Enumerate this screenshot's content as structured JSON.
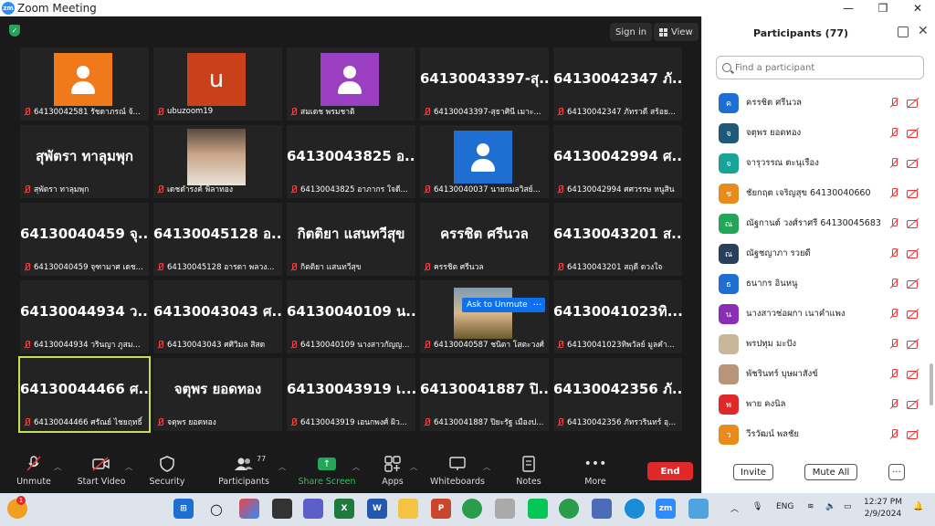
{
  "window": {
    "title": "Zoom Meeting",
    "logo_text": "zm"
  },
  "top_bar": {
    "sign_in": "Sign in",
    "view": "View"
  },
  "tiles": [
    {
      "kind": "avatar",
      "color": "#f07a1a",
      "name": "64130042581 รัชดาภรณ์ จ้..."
    },
    {
      "kind": "letter",
      "color": "#c9401b",
      "letter": "u",
      "name": "ubuzoom19"
    },
    {
      "kind": "avatar",
      "color": "#9a3fc1",
      "name": "สมเดช พรมชาติ"
    },
    {
      "kind": "text",
      "big": "64130043397-สุ...",
      "name": "64130043397-สุธาศินี เมาะ..."
    },
    {
      "kind": "text",
      "big": "64130042347 ภั...",
      "name": "64130042347 ภัทรวดี สร้อย..."
    },
    {
      "kind": "text",
      "big": "สุพัตรา ทาลุมพุก",
      "name": "สุพัตรา ทาลุมพุก"
    },
    {
      "kind": "photo",
      "name": "เดชดำรงค์ พิลาทอง"
    },
    {
      "kind": "text",
      "big": "64130043825 อ...",
      "name": "64130043825 อาภากร ใจดี..."
    },
    {
      "kind": "avatar",
      "color": "#1e6fd1",
      "name": "64130040037 นายกมลวิสย์..."
    },
    {
      "kind": "text",
      "big": "64130042994 ศ...",
      "name": "64130042994 ศศวรรษ หนูสิน"
    },
    {
      "kind": "text",
      "big": "64130040459 จุ...",
      "name": "64130040459 จุฑามาศ เดช..."
    },
    {
      "kind": "text",
      "big": "64130045128 อ...",
      "name": "64130045128 อารดา พลวง..."
    },
    {
      "kind": "text",
      "big": "กิตติยา แสนทวีสุข",
      "name": "กิตติยา แสนทวีสุข"
    },
    {
      "kind": "text",
      "big": "ครรชิต ศรีนวล",
      "name": "ครรชิต ศรีนวล"
    },
    {
      "kind": "text",
      "big": "64130043201 ส...",
      "name": "64130043201 สฤดี ดวงใจ"
    },
    {
      "kind": "text",
      "big": "64130044934 ว...",
      "name": "64130044934 วรินญา ภูสม..."
    },
    {
      "kind": "text",
      "big": "64130043043 ศ...",
      "name": "64130043043 ศศิวิมล สิสด"
    },
    {
      "kind": "text",
      "big": "64130040109 น...",
      "name": "64130040109 นางสาวกัญญ..."
    },
    {
      "kind": "photo2",
      "name": "64130040587 ชนิตา โสตะวงศ์"
    },
    {
      "kind": "text",
      "big": "64130041023ทิ...",
      "name": "64130041023ทิพวัลย์ มูลคำ..."
    },
    {
      "kind": "text",
      "big": "64130044466 ศ...",
      "name": "64130044466 ศรัณย์ ไชยฤทธิ์",
      "active": true
    },
    {
      "kind": "text",
      "big": "จตุพร ยอดทอง",
      "name": "จตุพร ยอดทอง"
    },
    {
      "kind": "text",
      "big": "64130043919 เ...",
      "name": "64130043919 เอนกพงศ์ ผิว..."
    },
    {
      "kind": "text",
      "big": "64130041887 ปิ...",
      "name": "64130041887 ปิยะรัฐ เมืองป..."
    },
    {
      "kind": "text",
      "big": "64130042356 ภั...",
      "name": "64130042356 ภัทรวรินทร์ อุ..."
    }
  ],
  "overlay": {
    "ask_unmute": "Ask to Unmute",
    "more": "···"
  },
  "toolbar": {
    "unmute": "Unmute",
    "start_video": "Start Video",
    "security": "Security",
    "participants": "Participants",
    "participant_count": "77",
    "share_screen": "Share Screen",
    "apps": "Apps",
    "whiteboards": "Whiteboards",
    "notes": "Notes",
    "more": "More",
    "end": "End"
  },
  "panel": {
    "title": "Participants (77)",
    "search_placeholder": "Find a participant",
    "participants": [
      {
        "initial": "ค",
        "color": "#1e6fd1",
        "name": "ครรชิต ศรีนวล"
      },
      {
        "initial": "จ",
        "color": "#1d5a7a",
        "name": "จตุพร ยอดทอง"
      },
      {
        "initial": "จ",
        "color": "#17a398",
        "name": "จารุวรรณ ตะนุเรือง"
      },
      {
        "initial": "ช",
        "color": "#e88b1a",
        "name": "ชัยกฤต เจริญสุข 64130040660"
      },
      {
        "initial": "ณ",
        "color": "#23a55a",
        "name": "ณัฐกานต์ วงศ์ราศรี 64130045683"
      },
      {
        "initial": "ณ",
        "color": "#2a3f5c",
        "name": "ณัฐชญาภา รวยดี"
      },
      {
        "initial": "ธ",
        "color": "#1e6fd1",
        "name": "ธนากร อินหนู"
      },
      {
        "initial": "น",
        "color": "#8a2fb5",
        "name": "นางสาวช่อผกา เนาคำแพง"
      },
      {
        "initial": "",
        "color": "#c9b79a",
        "name": "พรปทุม มะปัง"
      },
      {
        "initial": "",
        "color": "#b89478",
        "name": "พัชรินทร์ บุษผาสังข์"
      },
      {
        "initial": "พ",
        "color": "#e02828",
        "name": "พาย คงนิล"
      },
      {
        "initial": "ว",
        "color": "#e88b1a",
        "name": "วีรวัฒน์ พลชัย"
      }
    ],
    "invite": "Invite",
    "mute_all": "Mute All",
    "more": "···"
  },
  "taskbar": {
    "notification_count": "1",
    "lang": "ENG",
    "time": "12:27 PM",
    "date": "2/9/2024"
  }
}
